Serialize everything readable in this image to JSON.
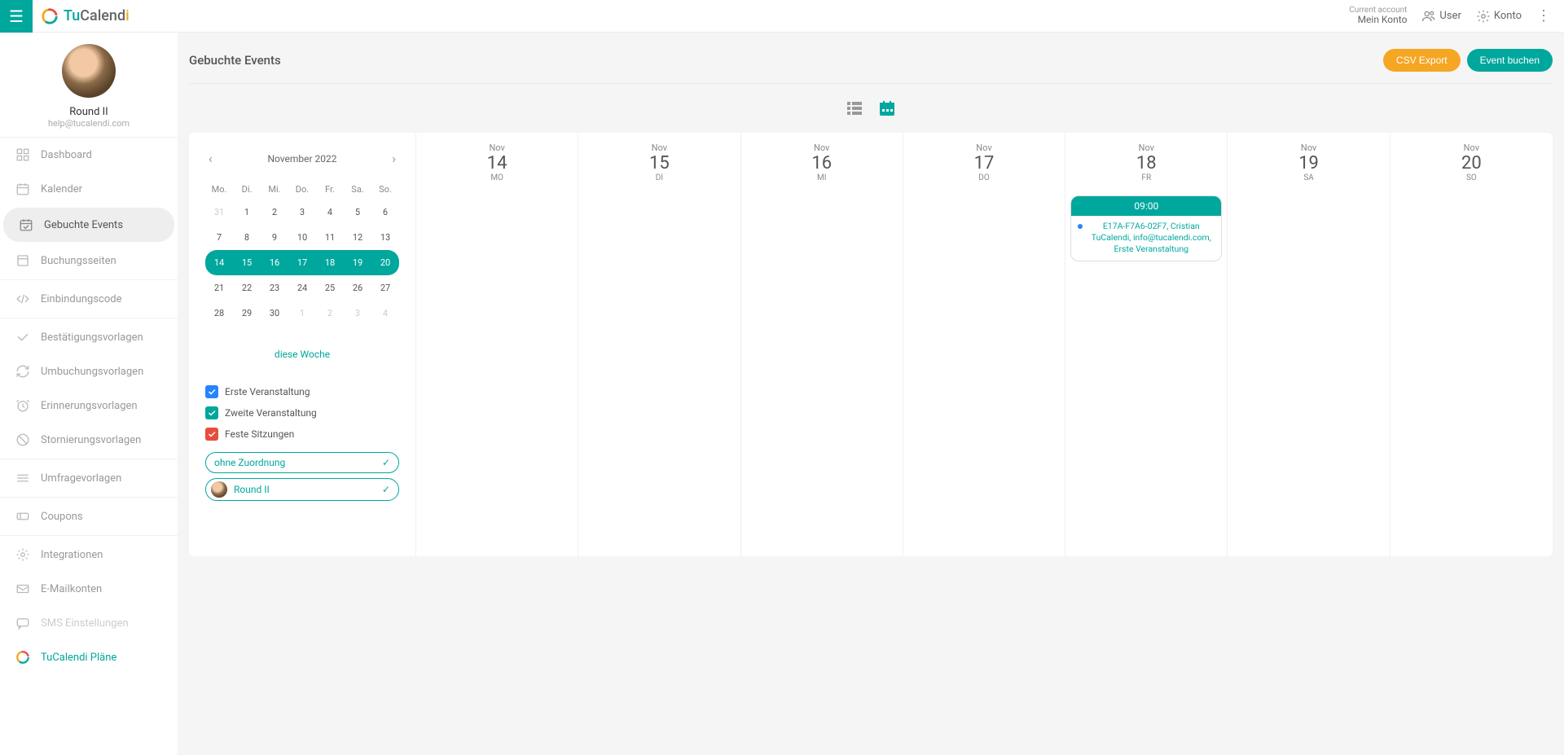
{
  "brand": {
    "part1": "Tu",
    "part2": "Calend",
    "part3": "i"
  },
  "topbar": {
    "current_account_label": "Current account",
    "current_account_value": "Mein Konto",
    "user_link": "User",
    "konto_link": "Konto"
  },
  "profile": {
    "name": "Round II",
    "email": "help@tucalendi.com"
  },
  "nav": {
    "dashboard": "Dashboard",
    "kalender": "Kalender",
    "gebuchte_events": "Gebuchte Events",
    "buchungsseiten": "Buchungsseiten",
    "einbindungscode": "Einbindungscode",
    "bestaetigungsvorlagen": "Bestätigungsvorlagen",
    "umbuchungsvorlagen": "Umbuchungsvorlagen",
    "erinnerungsvorlagen": "Erinnerungsvorlagen",
    "stornierungsvorlagen": "Stornierungsvorlagen",
    "umfragevorlagen": "Umfragevorlagen",
    "coupons": "Coupons",
    "integrationen": "Integrationen",
    "emailkonten": "E-Mailkonten",
    "sms": "SMS Einstellungen",
    "plans": "TuCalendi Pläne"
  },
  "page": {
    "title": "Gebuchte Events",
    "csv_export": "CSV Export",
    "event_buchen": "Event buchen"
  },
  "calendar": {
    "month_label": "November 2022",
    "dow": [
      "Mo.",
      "Di.",
      "Mi.",
      "Do.",
      "Fr.",
      "Sa.",
      "So."
    ],
    "weeks": [
      [
        {
          "n": "31",
          "muted": true
        },
        {
          "n": "1"
        },
        {
          "n": "2"
        },
        {
          "n": "3"
        },
        {
          "n": "4"
        },
        {
          "n": "5"
        },
        {
          "n": "6"
        }
      ],
      [
        {
          "n": "7"
        },
        {
          "n": "8"
        },
        {
          "n": "9"
        },
        {
          "n": "10"
        },
        {
          "n": "11"
        },
        {
          "n": "12"
        },
        {
          "n": "13"
        }
      ],
      [
        {
          "n": "14",
          "sel": "first"
        },
        {
          "n": "15",
          "sel": "mid"
        },
        {
          "n": "16",
          "sel": "mid"
        },
        {
          "n": "17",
          "sel": "mid"
        },
        {
          "n": "18",
          "sel": "mid"
        },
        {
          "n": "19",
          "sel": "mid"
        },
        {
          "n": "20",
          "sel": "last"
        }
      ],
      [
        {
          "n": "21"
        },
        {
          "n": "22"
        },
        {
          "n": "23"
        },
        {
          "n": "24"
        },
        {
          "n": "25"
        },
        {
          "n": "26"
        },
        {
          "n": "27"
        }
      ],
      [
        {
          "n": "28"
        },
        {
          "n": "29"
        },
        {
          "n": "30"
        },
        {
          "n": "1",
          "muted": true
        },
        {
          "n": "2",
          "muted": true
        },
        {
          "n": "3",
          "muted": true
        },
        {
          "n": "4",
          "muted": true
        }
      ]
    ],
    "this_week": "diese Woche"
  },
  "filters": {
    "first_event": "Erste Veranstaltung",
    "second_event": "Zweite Veranstaltung",
    "fixed_sessions": "Feste Sitzungen",
    "unassigned": "ohne Zuordnung",
    "round2": "Round II"
  },
  "week": {
    "days": [
      {
        "mon": "Nov",
        "num": "14",
        "dow": "MO"
      },
      {
        "mon": "Nov",
        "num": "15",
        "dow": "DI"
      },
      {
        "mon": "Nov",
        "num": "16",
        "dow": "MI"
      },
      {
        "mon": "Nov",
        "num": "17",
        "dow": "DO"
      },
      {
        "mon": "Nov",
        "num": "18",
        "dow": "FR"
      },
      {
        "mon": "Nov",
        "num": "19",
        "dow": "SA"
      },
      {
        "mon": "Nov",
        "num": "20",
        "dow": "SO"
      }
    ],
    "event": {
      "time": "09:00",
      "desc": "E17A-F7A6-02F7, Cristian TuCalendi, info@tucalendi.com, Erste Veranstaltung"
    }
  }
}
